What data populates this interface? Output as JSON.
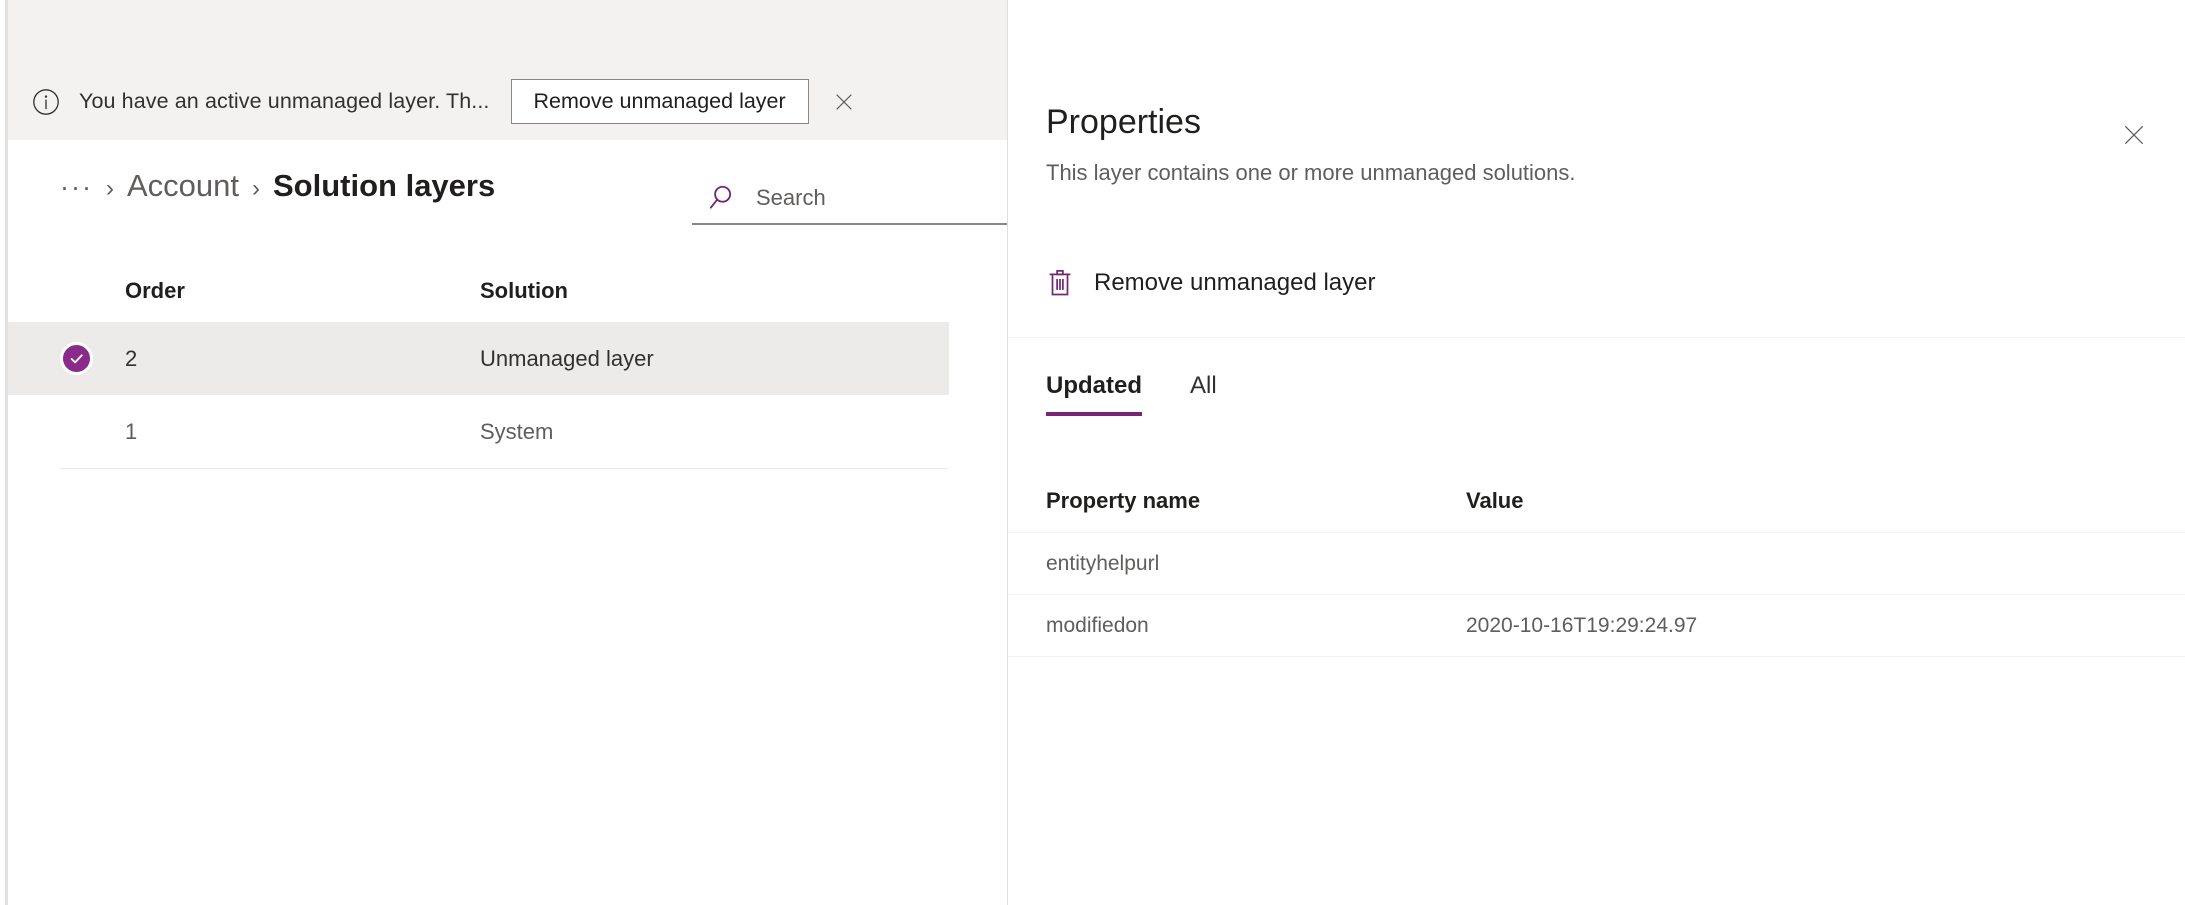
{
  "message_bar": {
    "icon": "info-icon",
    "text": "You have an active unmanaged layer. Th...",
    "action_label": "Remove unmanaged layer",
    "close_icon": "close-icon"
  },
  "breadcrumb": {
    "overflow": "···",
    "separator": "›",
    "parent": "Account",
    "current": "Solution layers"
  },
  "search": {
    "icon": "search-icon",
    "placeholder": "Search",
    "value": ""
  },
  "layers_table": {
    "columns": [
      "Order",
      "Solution"
    ],
    "rows": [
      {
        "selected": true,
        "order": "2",
        "solution": "Unmanaged layer"
      },
      {
        "selected": false,
        "order": "1",
        "solution": "System"
      }
    ]
  },
  "panel": {
    "title": "Properties",
    "subtitle": "This layer contains one or more unmanaged solutions.",
    "close_icon": "close-icon",
    "command": {
      "icon": "trash-icon",
      "label": "Remove unmanaged layer"
    },
    "tabs": [
      {
        "label": "Updated",
        "active": true
      },
      {
        "label": "All",
        "active": false
      }
    ],
    "property_table": {
      "columns": [
        "Property name",
        "Value"
      ],
      "rows": [
        {
          "name": "entityhelpurl",
          "value": ""
        },
        {
          "name": "modifiedon",
          "value": "2020-10-16T19:29:24.97"
        }
      ]
    }
  },
  "colors": {
    "accent": "#742774",
    "selection": "#8a2a8a",
    "chrome": "#f3f2f1",
    "row_selected": "#edebe9",
    "text_primary": "#201f1e",
    "text_secondary": "#605e5c"
  }
}
